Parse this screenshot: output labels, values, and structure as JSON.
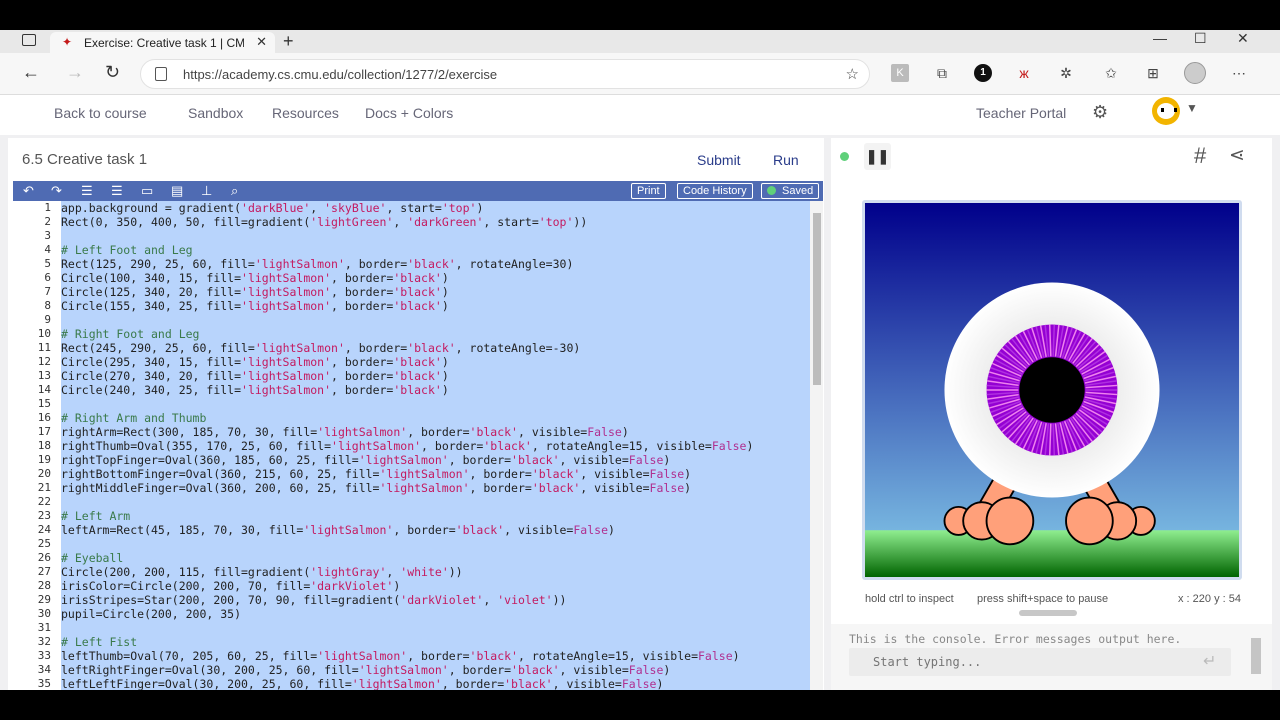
{
  "browser": {
    "tab_title": "Exercise: Creative task 1 | CMU C",
    "url": "https://academy.cs.cmu.edu/collection/1277/2/exercise",
    "new_tab_glyph": "+",
    "close_glyph": "✕"
  },
  "nav": {
    "back_to_course": "Back to course",
    "sandbox": "Sandbox",
    "resources": "Resources",
    "docs_colors": "Docs + Colors",
    "teacher_portal": "Teacher Portal"
  },
  "editor": {
    "exercise_title": "6.5 Creative task 1",
    "submit_label": "Submit",
    "run_label": "Run",
    "print_label": "Print",
    "code_history_label": "Code History",
    "saved_label": "Saved",
    "lines": [
      {
        "n": "1",
        "parts": [
          [
            "app.background = gradient(",
            ""
          ],
          [
            "'darkBlue'",
            "s"
          ],
          [
            ", ",
            ""
          ],
          [
            "'skyBlue'",
            "s"
          ],
          [
            ", start=",
            ""
          ],
          [
            "'top'",
            "s"
          ],
          [
            ")",
            ""
          ]
        ]
      },
      {
        "n": "2",
        "parts": [
          [
            "Rect(0, 350, 400, 50, fill=gradient(",
            ""
          ],
          [
            "'lightGreen'",
            "s"
          ],
          [
            ", ",
            ""
          ],
          [
            "'darkGreen'",
            "s"
          ],
          [
            ", start=",
            ""
          ],
          [
            "'top'",
            "s"
          ],
          [
            "))",
            ""
          ]
        ]
      },
      {
        "n": "3",
        "parts": []
      },
      {
        "n": "4",
        "parts": [
          [
            "# Left Foot and Leg",
            "c"
          ]
        ]
      },
      {
        "n": "5",
        "parts": [
          [
            "Rect(125, 290, 25, 60, fill=",
            ""
          ],
          [
            "'lightSalmon'",
            "s"
          ],
          [
            ", border=",
            ""
          ],
          [
            "'black'",
            "s"
          ],
          [
            ", rotateAngle=30)",
            ""
          ]
        ]
      },
      {
        "n": "6",
        "parts": [
          [
            "Circle(100, 340, 15, fill=",
            ""
          ],
          [
            "'lightSalmon'",
            "s"
          ],
          [
            ", border=",
            ""
          ],
          [
            "'black'",
            "s"
          ],
          [
            ")",
            ""
          ]
        ]
      },
      {
        "n": "7",
        "parts": [
          [
            "Circle(125, 340, 20, fill=",
            ""
          ],
          [
            "'lightSalmon'",
            "s"
          ],
          [
            ", border=",
            ""
          ],
          [
            "'black'",
            "s"
          ],
          [
            ")",
            ""
          ]
        ]
      },
      {
        "n": "8",
        "parts": [
          [
            "Circle(155, 340, 25, fill=",
            ""
          ],
          [
            "'lightSalmon'",
            "s"
          ],
          [
            ", border=",
            ""
          ],
          [
            "'black'",
            "s"
          ],
          [
            ")",
            ""
          ]
        ]
      },
      {
        "n": "9",
        "parts": []
      },
      {
        "n": "10",
        "parts": [
          [
            "# Right Foot and Leg",
            "c"
          ]
        ]
      },
      {
        "n": "11",
        "parts": [
          [
            "Rect(245, 290, 25, 60, fill=",
            ""
          ],
          [
            "'lightSalmon'",
            "s"
          ],
          [
            ", border=",
            ""
          ],
          [
            "'black'",
            "s"
          ],
          [
            ", rotateAngle=-30)",
            ""
          ]
        ]
      },
      {
        "n": "12",
        "parts": [
          [
            "Circle(295, 340, 15, fill=",
            ""
          ],
          [
            "'lightSalmon'",
            "s"
          ],
          [
            ", border=",
            ""
          ],
          [
            "'black'",
            "s"
          ],
          [
            ")",
            ""
          ]
        ]
      },
      {
        "n": "13",
        "parts": [
          [
            "Circle(270, 340, 20, fill=",
            ""
          ],
          [
            "'lightSalmon'",
            "s"
          ],
          [
            ", border=",
            ""
          ],
          [
            "'black'",
            "s"
          ],
          [
            ")",
            ""
          ]
        ]
      },
      {
        "n": "14",
        "parts": [
          [
            "Circle(240, 340, 25, fill=",
            ""
          ],
          [
            "'lightSalmon'",
            "s"
          ],
          [
            ", border=",
            ""
          ],
          [
            "'black'",
            "s"
          ],
          [
            ")",
            ""
          ]
        ]
      },
      {
        "n": "15",
        "parts": []
      },
      {
        "n": "16",
        "parts": [
          [
            "# Right Arm and Thumb",
            "c"
          ]
        ]
      },
      {
        "n": "17",
        "parts": [
          [
            "rightArm=Rect(300, 185, 70, 30, fill=",
            ""
          ],
          [
            "'lightSalmon'",
            "s"
          ],
          [
            ", border=",
            ""
          ],
          [
            "'black'",
            "s"
          ],
          [
            ", visible=",
            ""
          ],
          [
            "False",
            "k"
          ],
          [
            ")",
            ""
          ]
        ]
      },
      {
        "n": "18",
        "parts": [
          [
            "rightThumb=Oval(355, 170, 25, 60, fill=",
            ""
          ],
          [
            "'lightSalmon'",
            "s"
          ],
          [
            ", border=",
            ""
          ],
          [
            "'black'",
            "s"
          ],
          [
            ", rotateAngle=15, visible=",
            ""
          ],
          [
            "False",
            "k"
          ],
          [
            ")",
            ""
          ]
        ]
      },
      {
        "n": "19",
        "parts": [
          [
            "rightTopFinger=Oval(360, 185, 60, 25, fill=",
            ""
          ],
          [
            "'lightSalmon'",
            "s"
          ],
          [
            ", border=",
            ""
          ],
          [
            "'black'",
            "s"
          ],
          [
            ", visible=",
            ""
          ],
          [
            "False",
            "k"
          ],
          [
            ")",
            ""
          ]
        ]
      },
      {
        "n": "20",
        "parts": [
          [
            "rightBottomFinger=Oval(360, 215, 60, 25, fill=",
            ""
          ],
          [
            "'lightSalmon'",
            "s"
          ],
          [
            ", border=",
            ""
          ],
          [
            "'black'",
            "s"
          ],
          [
            ", visible=",
            ""
          ],
          [
            "False",
            "k"
          ],
          [
            ")",
            ""
          ]
        ]
      },
      {
        "n": "21",
        "parts": [
          [
            "rightMiddleFinger=Oval(360, 200, 60, 25, fill=",
            ""
          ],
          [
            "'lightSalmon'",
            "s"
          ],
          [
            ", border=",
            ""
          ],
          [
            "'black'",
            "s"
          ],
          [
            ", visible=",
            ""
          ],
          [
            "False",
            "k"
          ],
          [
            ")",
            ""
          ]
        ]
      },
      {
        "n": "22",
        "parts": []
      },
      {
        "n": "23",
        "parts": [
          [
            "# Left Arm",
            "c"
          ]
        ]
      },
      {
        "n": "24",
        "parts": [
          [
            "leftArm=Rect(45, 185, 70, 30, fill=",
            ""
          ],
          [
            "'lightSalmon'",
            "s"
          ],
          [
            ", border=",
            ""
          ],
          [
            "'black'",
            "s"
          ],
          [
            ", visible=",
            ""
          ],
          [
            "False",
            "k"
          ],
          [
            ")",
            ""
          ]
        ]
      },
      {
        "n": "25",
        "parts": []
      },
      {
        "n": "26",
        "parts": [
          [
            "# Eyeball",
            "c"
          ]
        ]
      },
      {
        "n": "27",
        "parts": [
          [
            "Circle(200, 200, 115, fill=gradient(",
            ""
          ],
          [
            "'lightGray'",
            "s"
          ],
          [
            ", ",
            ""
          ],
          [
            "'white'",
            "s"
          ],
          [
            "))",
            ""
          ]
        ]
      },
      {
        "n": "28",
        "parts": [
          [
            "irisColor=Circle(200, 200, 70, fill=",
            ""
          ],
          [
            "'darkViolet'",
            "s"
          ],
          [
            ")",
            ""
          ]
        ]
      },
      {
        "n": "29",
        "parts": [
          [
            "irisStripes=Star(200, 200, 70, 90, fill=gradient(",
            ""
          ],
          [
            "'darkViolet'",
            "s"
          ],
          [
            ", ",
            ""
          ],
          [
            "'violet'",
            "s"
          ],
          [
            "))",
            ""
          ]
        ]
      },
      {
        "n": "30",
        "parts": [
          [
            "pupil=Circle(200, 200, 35)",
            ""
          ]
        ]
      },
      {
        "n": "31",
        "parts": []
      },
      {
        "n": "32",
        "parts": [
          [
            "# Left Fist",
            "c"
          ]
        ]
      },
      {
        "n": "33",
        "parts": [
          [
            "leftThumb=Oval(70, 205, 60, 25, fill=",
            ""
          ],
          [
            "'lightSalmon'",
            "s"
          ],
          [
            ", border=",
            ""
          ],
          [
            "'black'",
            "s"
          ],
          [
            ", rotateAngle=15, visible=",
            ""
          ],
          [
            "False",
            "k"
          ],
          [
            ")",
            ""
          ]
        ]
      },
      {
        "n": "34",
        "parts": [
          [
            "leftRightFinger=Oval(30, 200, 25, 60, fill=",
            ""
          ],
          [
            "'lightSalmon'",
            "s"
          ],
          [
            ", border=",
            ""
          ],
          [
            "'black'",
            "s"
          ],
          [
            ", visible=",
            ""
          ],
          [
            "False",
            "k"
          ],
          [
            ")",
            ""
          ]
        ]
      },
      {
        "n": "35",
        "parts": [
          [
            "leftLeftFinger=Oval(30, 200, 25, 60, fill=",
            ""
          ],
          [
            "'lightSalmon'",
            "s"
          ],
          [
            ", border=",
            ""
          ],
          [
            "'black'",
            "s"
          ],
          [
            ", visible=",
            ""
          ],
          [
            "False",
            "k"
          ],
          [
            ")",
            ""
          ]
        ]
      }
    ]
  },
  "output": {
    "hint_inspect": "hold ctrl to inspect",
    "hint_pause": "press shift+space to pause",
    "coords": "x : 220 y : 54",
    "console_message": "This is the console. Error messages output here.",
    "console_placeholder": "Start typing..."
  },
  "colors": {
    "accent": "#4f6bb3",
    "code_highlight": "#b8d4fc",
    "live": "#5fd07a",
    "iris": "#9400d3"
  }
}
